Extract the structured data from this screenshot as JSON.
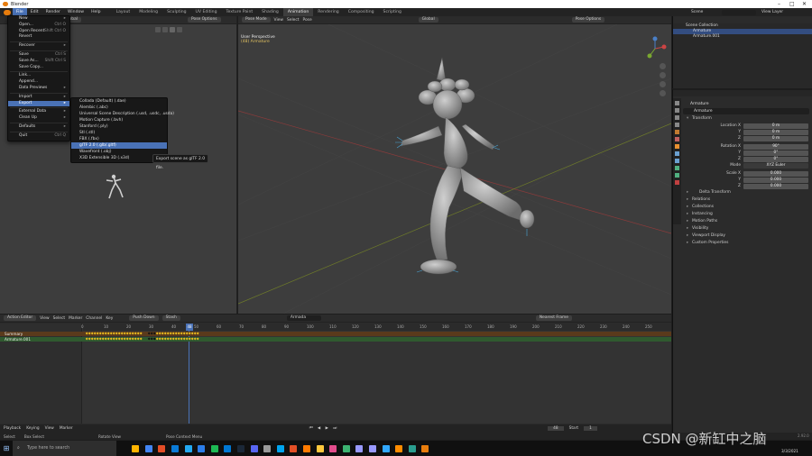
{
  "window": {
    "title": "Blender"
  },
  "menubar": [
    "File",
    "Edit",
    "Render",
    "Window",
    "Help"
  ],
  "workspaces": [
    "Layout",
    "Modeling",
    "Sculpting",
    "UV Editing",
    "Texture Paint",
    "Shading",
    "Animation",
    "Rendering",
    "Compositing",
    "Scripting"
  ],
  "scene": {
    "label": "Scene",
    "view_layer": "View Layer"
  },
  "left_view": {
    "orient": "Global",
    "options": "Pose Options"
  },
  "right_view": {
    "mode": "Pose Mode",
    "menus": [
      "View",
      "Select",
      "Pose"
    ],
    "orient": "Global",
    "options": "Pose Options",
    "overlay_title": "User Perspective",
    "overlay_sub": "(48) Armature"
  },
  "file_menu": {
    "items": [
      {
        "label": "New",
        "shortcut": "▸"
      },
      {
        "label": "Open...",
        "shortcut": "Ctrl O"
      },
      {
        "label": "Open Recent",
        "shortcut": "Shift Ctrl O"
      },
      {
        "label": "Revert",
        "shortcut": ""
      },
      {
        "label": "Recover",
        "shortcut": "▸"
      },
      {
        "label": "Save",
        "shortcut": "Ctrl S"
      },
      {
        "label": "Save As...",
        "shortcut": "Shift Ctrl S"
      },
      {
        "label": "Save Copy...",
        "shortcut": ""
      },
      {
        "label": "Link...",
        "shortcut": ""
      },
      {
        "label": "Append...",
        "shortcut": ""
      },
      {
        "label": "Data Previews",
        "shortcut": "▸"
      },
      {
        "label": "Import",
        "shortcut": "▸"
      },
      {
        "label": "Export",
        "shortcut": "▸"
      },
      {
        "label": "External Data",
        "shortcut": "▸"
      },
      {
        "label": "Clean Up",
        "shortcut": "▸"
      },
      {
        "label": "Defaults",
        "shortcut": "▸"
      },
      {
        "label": "Quit",
        "shortcut": "Ctrl Q"
      }
    ]
  },
  "export_menu": {
    "items": [
      "Collada (Default) (.dae)",
      "Alembic (.abc)",
      "Universal Scene Description (.usd, .usdc, .usda)",
      "Motion Capture (.bvh)",
      "Stanford (.ply)",
      "Stl (.stl)",
      "FBX (.fbx)",
      "glTF 2.0 (.glb/.gltf)",
      "Wavefront (.obj)",
      "X3D Extensible 3D (.x3d)"
    ],
    "tooltip": "Export scene as glTF 2.0 file."
  },
  "outliner": {
    "rows": [
      "Scene Collection",
      "Armature",
      "Armature.001"
    ]
  },
  "properties": {
    "object_name": "Armature",
    "data_name": "Armature",
    "transform_title": "Transform",
    "location": [
      {
        "axis": "Location X",
        "value": "0 m"
      },
      {
        "axis": "Y",
        "value": "0 m"
      },
      {
        "axis": "Z",
        "value": "0 m"
      }
    ],
    "rotation": [
      {
        "axis": "Rotation X",
        "value": "90°"
      },
      {
        "axis": "Y",
        "value": "0°"
      },
      {
        "axis": "Z",
        "value": "0°"
      }
    ],
    "mode": {
      "label": "Mode",
      "value": "XYZ Euler"
    },
    "scale": [
      {
        "axis": "Scale X",
        "value": "0.000"
      },
      {
        "axis": "Y",
        "value": "0.000"
      },
      {
        "axis": "Z",
        "value": "0.000"
      }
    ],
    "delta": "Delta Transform",
    "panels": [
      "Relations",
      "Collections",
      "Instancing",
      "Motion Paths",
      "Visibility",
      "Viewport Display",
      "Custom Properties"
    ]
  },
  "dopesheet": {
    "mode": "Action Editor",
    "menus": [
      "View",
      "Select",
      "Marker",
      "Channel",
      "Key"
    ],
    "pushdown": "Push Down",
    "stash": "Stash",
    "action": "Armada",
    "interp": "Nearest Frame",
    "channels": [
      "Summary",
      "Armature.001"
    ],
    "ruler": [
      "0",
      "10",
      "20",
      "30",
      "40",
      "50",
      "60",
      "70",
      "80",
      "90",
      "100",
      "110",
      "120",
      "130",
      "140",
      "150",
      "160",
      "170",
      "180",
      "190",
      "200",
      "210",
      "220",
      "230",
      "240",
      "250"
    ],
    "current_frame": "48"
  },
  "playback": {
    "playback": "Playback",
    "keying": "Keying",
    "view": "View",
    "marker": "Marker",
    "frame": "48",
    "start_label": "Start",
    "start": "1"
  },
  "status": {
    "items": [
      "Select",
      "Box Select",
      "Rotate View",
      "Pose Context Menu"
    ],
    "version": "2.92.0"
  },
  "taskbar": {
    "search": "Type here to search",
    "time": "",
    "date": "3/3/2021"
  },
  "watermark": "CSDN @新缸中之脑"
}
